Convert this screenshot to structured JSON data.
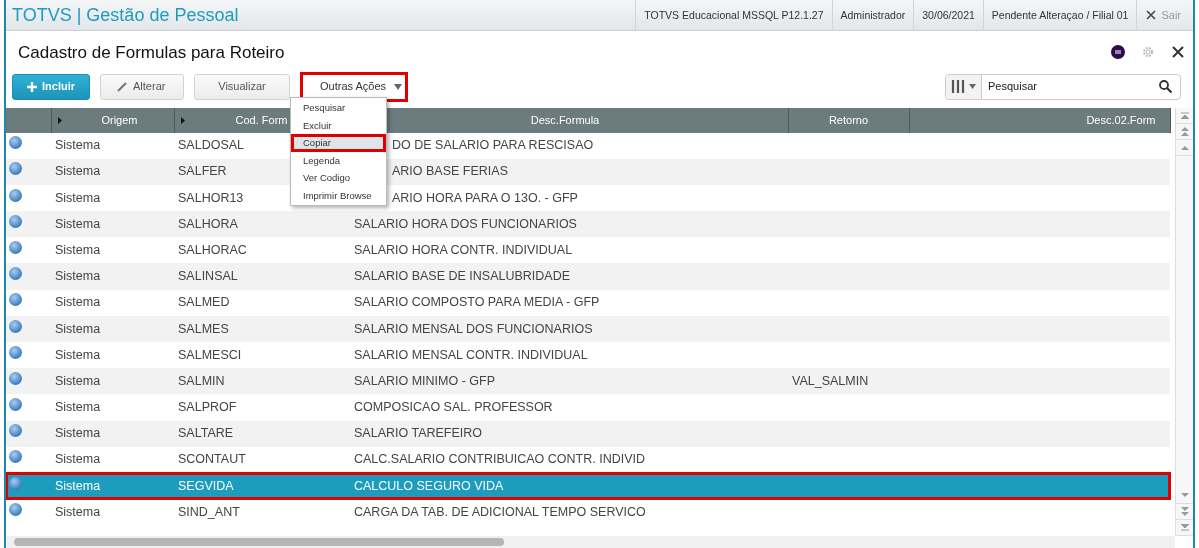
{
  "app": {
    "brand": "TOTVS",
    "separator": "|",
    "module": "Gestão de Pessoal",
    "info": [
      "TOTVS Educacional MSSQL P12.1.27",
      "Administrador",
      "30/06/2021",
      "Pendente Alteraçao / Filial 01"
    ],
    "exit": "Sair"
  },
  "page": {
    "title": "Cadastro de Formulas para Roteiro"
  },
  "toolbar": {
    "buttons": [
      {
        "label": "Incluir",
        "kind": "primary"
      },
      {
        "label": "Alterar",
        "kind": "edit"
      },
      {
        "label": "Visualizar",
        "kind": "plain"
      }
    ],
    "more": {
      "label": "Outras Ações",
      "highlighted": true,
      "expanded": true,
      "items": [
        {
          "label": "Pesquisar",
          "selected": false,
          "highlighted": false
        },
        {
          "label": "Excluir",
          "selected": false,
          "highlighted": false
        },
        {
          "label": "Copiar",
          "selected": true,
          "highlighted": true
        },
        {
          "label": "Legenda",
          "selected": false,
          "highlighted": false
        },
        {
          "label": "Ver Codigo",
          "selected": false,
          "highlighted": false
        },
        {
          "label": "Imprimir Browse",
          "selected": false,
          "highlighted": false
        }
      ]
    }
  },
  "search": {
    "placeholder": "Pesquisar"
  },
  "table": {
    "columns": [
      "Origem",
      "Cod. Form",
      "Desc.Formula",
      "Retorno",
      "Desc.02.Form"
    ],
    "rows": [
      {
        "origem": "Sistema",
        "code": "SALDOSAL",
        "desc": "DO DE SALARIO PARA RESCISAO",
        "retorno": "",
        "partly_hidden": true,
        "selected": false,
        "highlighted": false
      },
      {
        "origem": "Sistema",
        "code": "SALFER",
        "desc": "ARIO BASE FERIAS",
        "retorno": "",
        "partly_hidden": true,
        "selected": false,
        "highlighted": false
      },
      {
        "origem": "Sistema",
        "code": "SALHOR13",
        "desc": "ARIO HORA PARA O 13O. - GFP",
        "retorno": "",
        "partly_hidden": true,
        "selected": false,
        "highlighted": false
      },
      {
        "origem": "Sistema",
        "code": "SALHORA",
        "desc": "SALARIO HORA DOS FUNCIONARIOS",
        "retorno": "",
        "partly_hidden": false,
        "selected": false,
        "highlighted": false
      },
      {
        "origem": "Sistema",
        "code": "SALHORAC",
        "desc": "SALARIO HORA CONTR. INDIVIDUAL",
        "retorno": "",
        "partly_hidden": false,
        "selected": false,
        "highlighted": false
      },
      {
        "origem": "Sistema",
        "code": "SALINSAL",
        "desc": "SALARIO BASE DE INSALUBRIDADE",
        "retorno": "",
        "partly_hidden": false,
        "selected": false,
        "highlighted": false
      },
      {
        "origem": "Sistema",
        "code": "SALMED",
        "desc": "SALARIO COMPOSTO PARA MEDIA - GFP",
        "retorno": "",
        "partly_hidden": false,
        "selected": false,
        "highlighted": false
      },
      {
        "origem": "Sistema",
        "code": "SALMES",
        "desc": "SALARIO MENSAL DOS FUNCIONARIOS",
        "retorno": "",
        "partly_hidden": false,
        "selected": false,
        "highlighted": false
      },
      {
        "origem": "Sistema",
        "code": "SALMESCI",
        "desc": "SALARIO MENSAL CONTR. INDIVIDUAL",
        "retorno": "",
        "partly_hidden": false,
        "selected": false,
        "highlighted": false
      },
      {
        "origem": "Sistema",
        "code": "SALMIN",
        "desc": "SALARIO MINIMO - GFP",
        "retorno": "VAL_SALMIN",
        "partly_hidden": false,
        "selected": false,
        "highlighted": false
      },
      {
        "origem": "Sistema",
        "code": "SALPROF",
        "desc": "COMPOSICAO SAL. PROFESSOR",
        "retorno": "",
        "partly_hidden": false,
        "selected": false,
        "highlighted": false
      },
      {
        "origem": "Sistema",
        "code": "SALTARE",
        "desc": "SALARIO TAREFEIRO",
        "retorno": "",
        "partly_hidden": false,
        "selected": false,
        "highlighted": false
      },
      {
        "origem": "Sistema",
        "code": "SCONTAUT",
        "desc": "CALC.SALARIO CONTRIBUICAO CONTR. INDIVID",
        "retorno": "",
        "partly_hidden": false,
        "selected": false,
        "highlighted": false
      },
      {
        "origem": "Sistema",
        "code": "SEGVIDA",
        "desc": "CALCULO SEGURO VIDA",
        "retorno": "",
        "partly_hidden": false,
        "selected": true,
        "highlighted": true
      },
      {
        "origem": "Sistema",
        "code": "SIND_ANT",
        "desc": "CARGA DA TAB. DE ADICIONAL TEMPO SERVICO",
        "retorno": "",
        "partly_hidden": false,
        "selected": false,
        "highlighted": false
      }
    ]
  }
}
